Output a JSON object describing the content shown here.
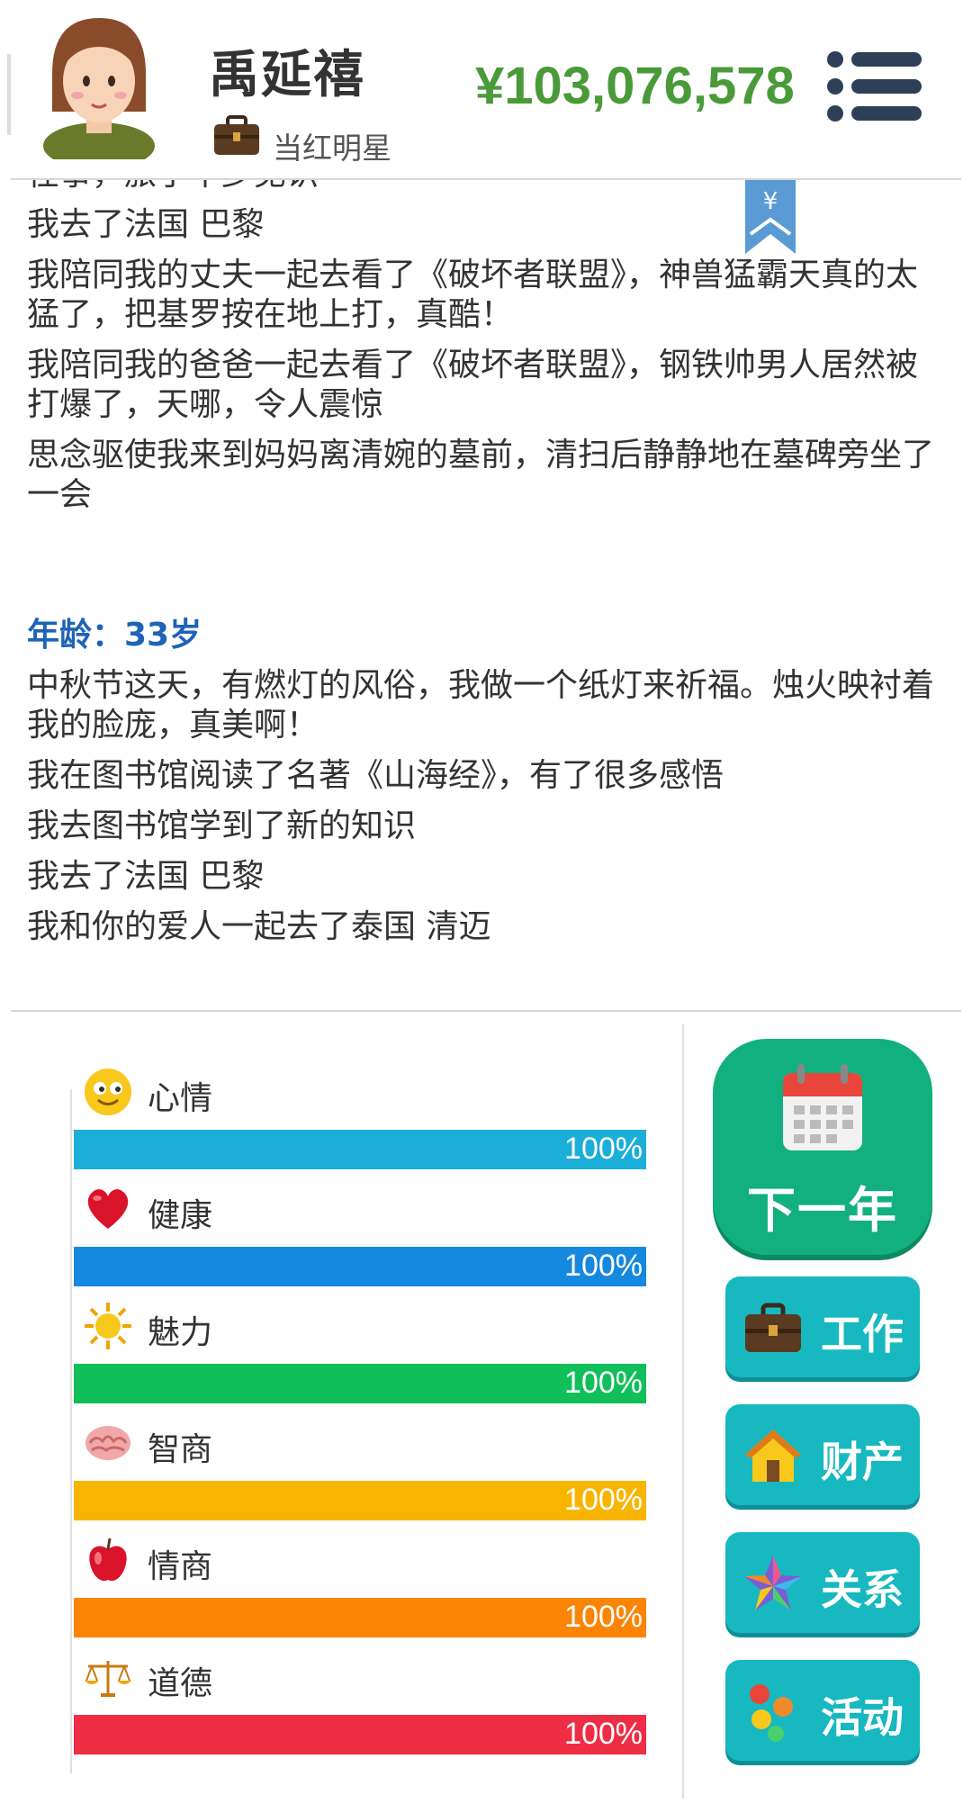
{
  "header": {
    "name": "禹延禧",
    "job": "当红明星",
    "money": "¥103,076,578"
  },
  "log": {
    "lines_before": [
      "任事，旅了不少见识",
      "我去了法国 巴黎",
      "我陪同我的丈夫一起去看了《破坏者联盟》，神兽猛霸天真的太猛了，把基罗按在地上打，真酷！",
      "我陪同我的爸爸一起去看了《破坏者联盟》，钢铁帅男人居然被打爆了，天哪，令人震惊",
      "思念驱使我来到妈妈离清婉的墓前，清扫后静静地在墓碑旁坐了一会"
    ],
    "age_label": "年龄：33岁",
    "lines_after": [
      "中秋节这天，有燃灯的风俗，我做一个纸灯来祈福。烛火映衬着我的脸庞，真美啊！",
      "我在图书馆阅读了名著《山海经》，有了很多感悟",
      "我去图书馆学到了新的知识",
      "我去了法国 巴黎",
      "我和你的爱人一起去了泰国 清迈"
    ]
  },
  "stats": [
    {
      "label": "心情",
      "value": 100,
      "display": "100%",
      "color": "#1aaed9",
      "icon": "smiley-icon"
    },
    {
      "label": "健康",
      "value": 100,
      "display": "100%",
      "color": "#1588e0",
      "icon": "heart-icon"
    },
    {
      "label": "魅力",
      "value": 100,
      "display": "100%",
      "color": "#11bf5a",
      "icon": "sun-icon"
    },
    {
      "label": "智商",
      "value": 100,
      "display": "100%",
      "color": "#f8b500",
      "icon": "brain-icon"
    },
    {
      "label": "情商",
      "value": 100,
      "display": "100%",
      "color": "#fb8405",
      "icon": "apple-icon"
    },
    {
      "label": "道德",
      "value": 100,
      "display": "100%",
      "color": "#ef2d45",
      "icon": "scales-icon"
    }
  ],
  "buttons": {
    "next_year": "下一年",
    "work": "工作",
    "property": "财产",
    "relations": "关系",
    "activity": "活动"
  }
}
